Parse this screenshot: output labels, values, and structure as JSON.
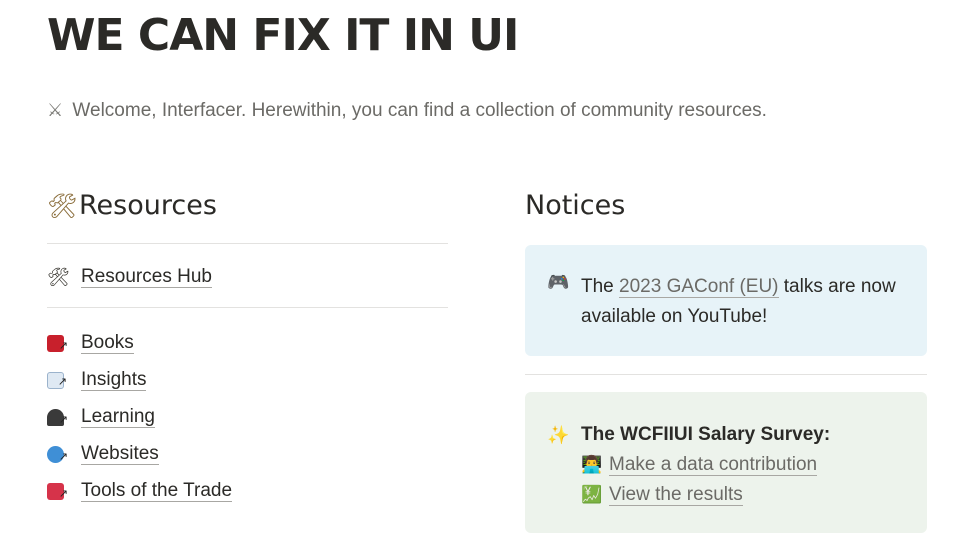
{
  "page": {
    "title": "WE CAN FIX IT IN UI",
    "intro_icon": "⚔",
    "intro": "Welcome, Interfacer. Herewithin, you can find a collection of community resources."
  },
  "resources": {
    "heading_icon": "🛠",
    "heading": "Resources",
    "hub": {
      "icon": "🛠",
      "label": "Resources Hub"
    },
    "links": [
      {
        "icon": "book-link-icon",
        "label": "Books"
      },
      {
        "icon": "insights-link-icon",
        "label": "Insights"
      },
      {
        "icon": "graduation-cap-link-icon",
        "label": "Learning"
      },
      {
        "icon": "globe-link-icon",
        "label": "Websites"
      },
      {
        "icon": "toolbox-link-icon",
        "label": "Tools of the Trade"
      }
    ]
  },
  "notices": {
    "heading": "Notices",
    "callout1": {
      "icon": "🎮",
      "prefix": "The ",
      "link": "2023 GAConf (EU)",
      "suffix": " talks are now available on YouTube!"
    },
    "callout2": {
      "icon": "✨",
      "title": "The WCFIIUI Salary Survey:",
      "links": [
        {
          "icon": "👨‍💻",
          "label": "Make a data contribution"
        },
        {
          "icon": "💹",
          "label": "View the results"
        }
      ]
    }
  },
  "colors": {
    "blue_callout": "#e7f3f8",
    "green_callout": "#edf3ec",
    "text": "#2b2a27",
    "muted": "#6b6a66"
  }
}
